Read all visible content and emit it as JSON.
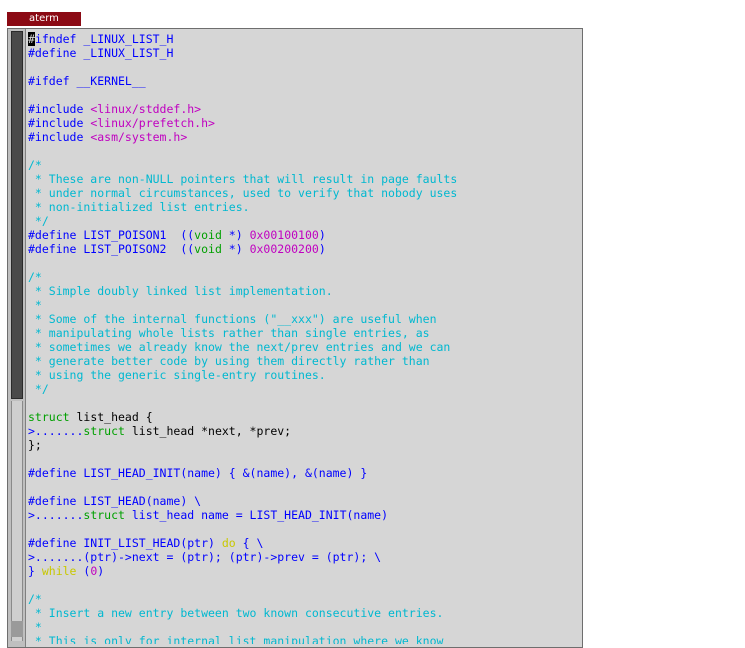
{
  "window": {
    "title": "aterm"
  },
  "colors": {
    "background": "#d6d6d6",
    "text": "#000000",
    "preprocessor": "#0000ff",
    "include_path": "#c000c0",
    "comment": "#00b8d0",
    "type_keyword": "#00a000",
    "control_keyword": "#c8c800",
    "number": "#c000c0",
    "title_tab": "#8b0a14"
  },
  "code_lines": [
    [
      {
        "t": "#ifndef _LINUX_LIST_H",
        "c": "preprocessor",
        "cursor": true
      }
    ],
    [
      {
        "t": "#define _LINUX_LIST_H",
        "c": "preprocessor"
      }
    ],
    [],
    [
      {
        "t": "#ifdef __KERNEL__",
        "c": "preprocessor"
      }
    ],
    [],
    [
      {
        "t": "#include ",
        "c": "preprocessor"
      },
      {
        "t": "<linux/stddef.h>",
        "c": "include_path"
      }
    ],
    [
      {
        "t": "#include ",
        "c": "preprocessor"
      },
      {
        "t": "<linux/prefetch.h>",
        "c": "include_path"
      }
    ],
    [
      {
        "t": "#include ",
        "c": "preprocessor"
      },
      {
        "t": "<asm/system.h>",
        "c": "include_path"
      }
    ],
    [],
    [
      {
        "t": "/*",
        "c": "comment"
      }
    ],
    [
      {
        "t": " * These are non-NULL pointers that will result in page faults",
        "c": "comment"
      }
    ],
    [
      {
        "t": " * under normal circumstances, used to verify that nobody uses",
        "c": "comment"
      }
    ],
    [
      {
        "t": " * non-initialized list entries.",
        "c": "comment"
      }
    ],
    [
      {
        "t": " */",
        "c": "comment"
      }
    ],
    [
      {
        "t": "#define LIST_POISON1  ((",
        "c": "preprocessor"
      },
      {
        "t": "void",
        "c": "type_keyword"
      },
      {
        "t": " *) ",
        "c": "preprocessor"
      },
      {
        "t": "0x00100100",
        "c": "number"
      },
      {
        "t": ")",
        "c": "preprocessor"
      }
    ],
    [
      {
        "t": "#define LIST_POISON2  ((",
        "c": "preprocessor"
      },
      {
        "t": "void",
        "c": "type_keyword"
      },
      {
        "t": " *) ",
        "c": "preprocessor"
      },
      {
        "t": "0x00200200",
        "c": "number"
      },
      {
        "t": ")",
        "c": "preprocessor"
      }
    ],
    [],
    [
      {
        "t": "/*",
        "c": "comment"
      }
    ],
    [
      {
        "t": " * Simple doubly linked list implementation.",
        "c": "comment"
      }
    ],
    [
      {
        "t": " *",
        "c": "comment"
      }
    ],
    [
      {
        "t": " * Some of the internal functions (\"__xxx\") are useful when",
        "c": "comment"
      }
    ],
    [
      {
        "t": " * manipulating whole lists rather than single entries, as",
        "c": "comment"
      }
    ],
    [
      {
        "t": " * sometimes we already know the next/prev entries and we can",
        "c": "comment"
      }
    ],
    [
      {
        "t": " * generate better code by using them directly rather than",
        "c": "comment"
      }
    ],
    [
      {
        "t": " * using the generic single-entry routines.",
        "c": "comment"
      }
    ],
    [
      {
        "t": " */",
        "c": "comment"
      }
    ],
    [],
    [
      {
        "t": "struct",
        "c": "type_keyword"
      },
      {
        "t": " list_head {",
        "c": "text"
      }
    ],
    [
      {
        "t": ">.......",
        "c": "preprocessor"
      },
      {
        "t": "struct",
        "c": "type_keyword"
      },
      {
        "t": " list_head *next, *prev;",
        "c": "text"
      }
    ],
    [
      {
        "t": "};",
        "c": "text"
      }
    ],
    [],
    [
      {
        "t": "#define LIST_HEAD_INIT(name) { &(name), &(name) }",
        "c": "preprocessor"
      }
    ],
    [],
    [
      {
        "t": "#define LIST_HEAD(name) \\",
        "c": "preprocessor"
      }
    ],
    [
      {
        "t": ">.......",
        "c": "preprocessor"
      },
      {
        "t": "struct",
        "c": "type_keyword"
      },
      {
        "t": " list_head name = LIST_HEAD_INIT(name)",
        "c": "preprocessor"
      }
    ],
    [],
    [
      {
        "t": "#define INIT_LIST_HEAD(ptr) ",
        "c": "preprocessor"
      },
      {
        "t": "do",
        "c": "control_keyword"
      },
      {
        "t": " { \\",
        "c": "preprocessor"
      }
    ],
    [
      {
        "t": ">.......(ptr)->next = (ptr); (ptr)->prev = (ptr); \\",
        "c": "preprocessor"
      }
    ],
    [
      {
        "t": "} ",
        "c": "preprocessor"
      },
      {
        "t": "while",
        "c": "control_keyword"
      },
      {
        "t": " (",
        "c": "preprocessor"
      },
      {
        "t": "0",
        "c": "number"
      },
      {
        "t": ")",
        "c": "preprocessor"
      }
    ],
    [],
    [
      {
        "t": "/*",
        "c": "comment"
      }
    ],
    [
      {
        "t": " * Insert a new entry between two known consecutive entries.",
        "c": "comment"
      }
    ],
    [
      {
        "t": " *",
        "c": "comment"
      }
    ],
    [
      {
        "t": " * This is only for internal list manipulation where we know",
        "c": "comment"
      }
    ]
  ]
}
